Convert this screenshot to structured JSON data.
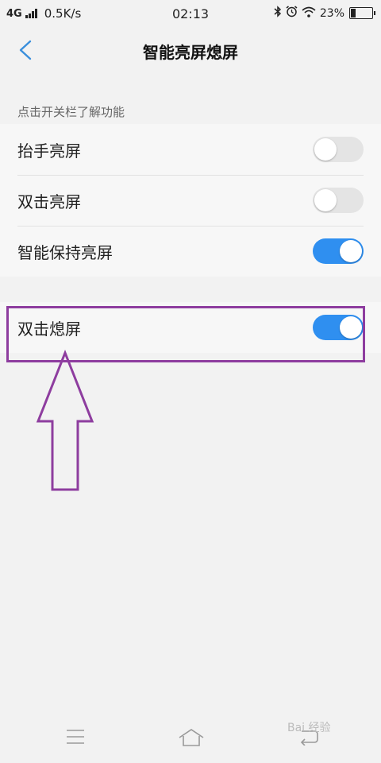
{
  "status_bar": {
    "network": "4G",
    "speed": "0.5K/s",
    "time": "02:13",
    "battery_text": "23%",
    "battery_level": 0.23,
    "icons": [
      "signal-icon",
      "bluetooth-icon",
      "alarm-icon",
      "wifi-icon",
      "battery-icon"
    ]
  },
  "header": {
    "title": "智能亮屏熄屏",
    "back_icon": "chevron-left-icon"
  },
  "section_hint": "点击开关栏了解功能",
  "settings": [
    {
      "label": "抬手亮屏",
      "enabled": false
    },
    {
      "label": "双击亮屏",
      "enabled": false
    },
    {
      "label": "智能保持亮屏",
      "enabled": true
    }
  ],
  "highlighted_setting": {
    "label": "双击熄屏",
    "enabled": true
  },
  "annotation": {
    "color": "#8e3d9f"
  },
  "colors": {
    "toggle_on": "#2f8ff0",
    "accent": "#3a8fdc"
  },
  "bottom_nav": {
    "icons": [
      "menu-icon",
      "home-icon",
      "back-icon"
    ]
  },
  "watermark": "Bai 经验"
}
